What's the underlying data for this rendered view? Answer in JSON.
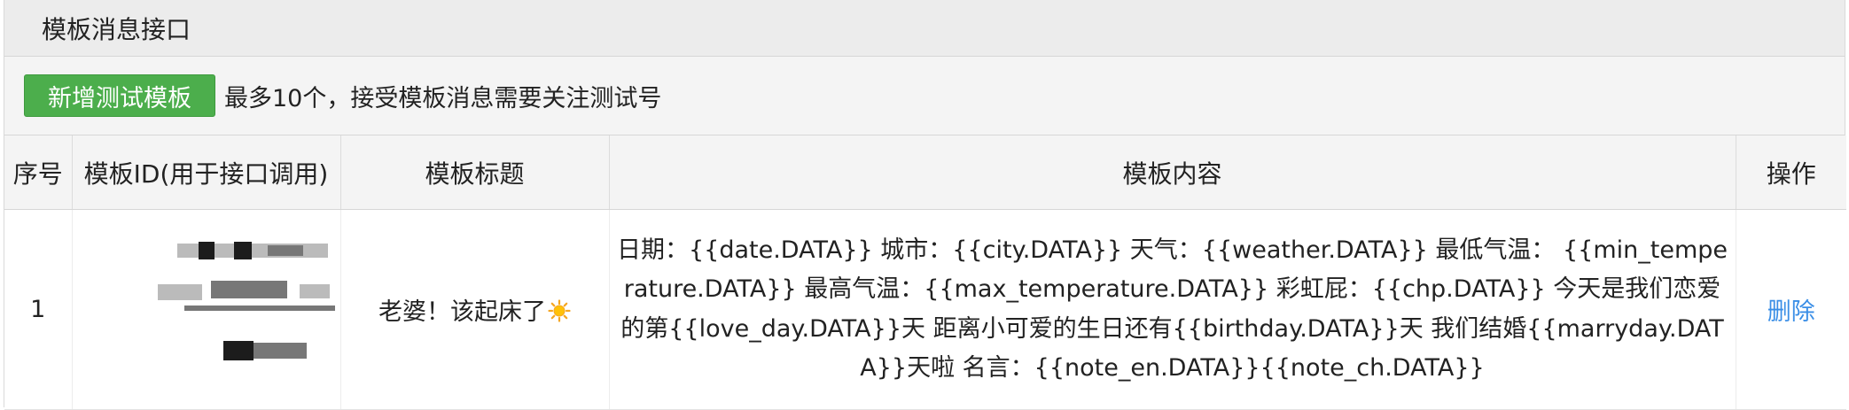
{
  "panel": {
    "title": "模板消息接口"
  },
  "toolbar": {
    "add_button_label": "新增测试模板",
    "note": "最多10个，接受模板消息需要关注测试号"
  },
  "table": {
    "columns": [
      "序号",
      "模板ID(用于接口调用)",
      "模板标题",
      "模板内容",
      "操作"
    ],
    "rows": [
      {
        "index": "1",
        "template_id": "",
        "title": "老婆！该起床了",
        "title_icon": "sun-icon",
        "content": "日期：{{date.DATA}} 城市：{{city.DATA}} 天气：{{weather.DATA}} 最低气温： {{min_temperature.DATA}} 最高气温：{{max_temperature.DATA}} 彩虹屁：{{chp.DATA}} 今天是我们恋爱的第{{love_day.DATA}}天 距离小可爱的生日还有{{birthday.DATA}}天 我们结婚{{marryday.DATA}}天啦 名言：{{note_en.DATA}}{{note_ch.DATA}}",
        "action": "删除"
      }
    ]
  }
}
